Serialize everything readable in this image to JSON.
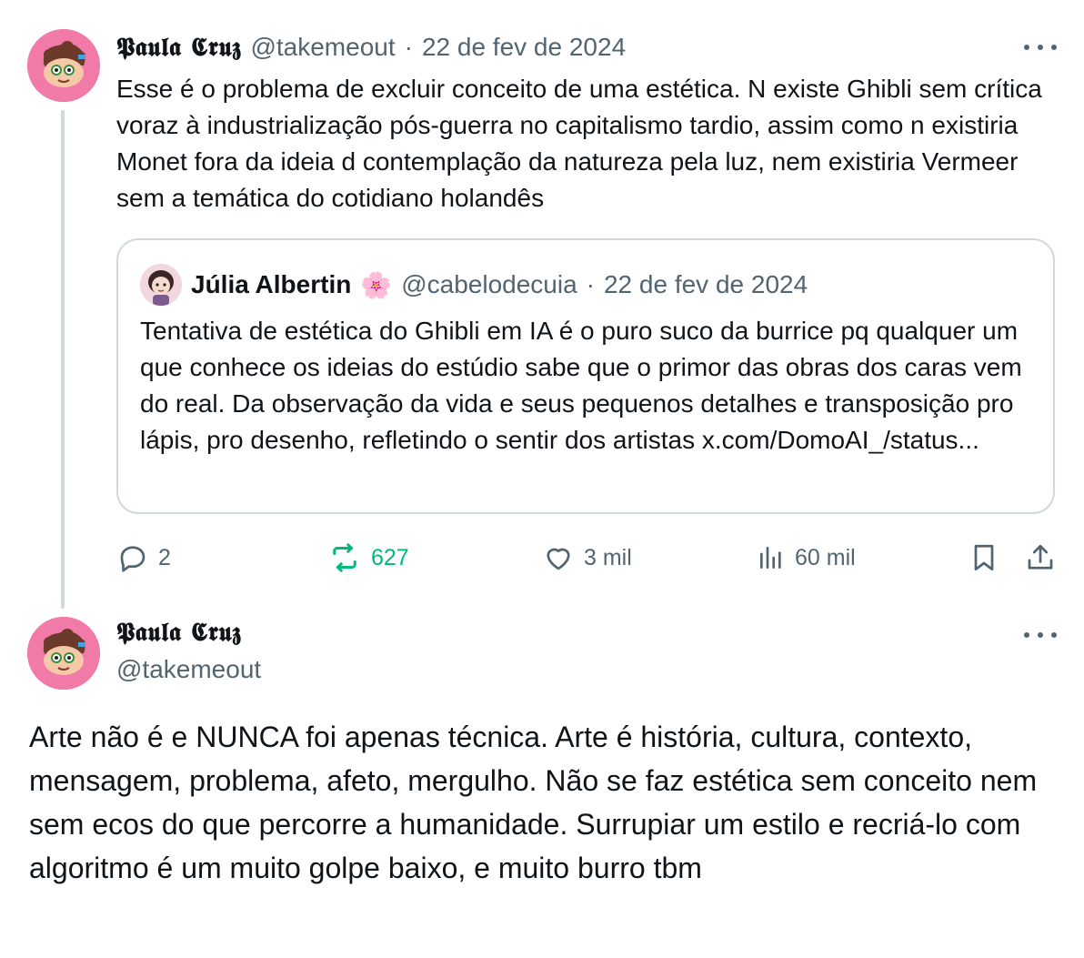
{
  "tweet1": {
    "author_name": "𝕻𝖆𝖚𝖑𝖆 𝕮𝖗𝖚𝖟",
    "handle": "@takemeout",
    "separator": "·",
    "date": "22 de fev de 2024",
    "text": "Esse é o problema de excluir conceito de uma estética. N existe Ghibli sem crítica voraz à industrialização pós-guerra no capitalismo tardio, assim como n existiria Monet fora da ideia d contemplação da natureza pela luz, nem existiria Vermeer sem a temática do cotidiano holandês",
    "quote": {
      "author_name": "Júlia Albertin",
      "emoji": "🌸",
      "handle": "@cabelodecuia",
      "separator": "·",
      "date": "22 de fev de 2024",
      "text": "Tentativa de estética do Ghibli em IA é o puro suco da burrice pq qualquer um que conhece os ideias do estúdio sabe que o primor das obras dos caras vem do real. Da observação da vida e seus pequenos detalhes e transposição pro lápis, pro desenho, refletindo o sentir dos artistas x.com/DomoAI_/status..."
    },
    "actions": {
      "replies": "2",
      "reposts": "627",
      "likes": "3 mil",
      "views": "60 mil"
    }
  },
  "tweet2": {
    "author_name": "𝕻𝖆𝖚𝖑𝖆 𝕮𝖗𝖚𝖟",
    "handle": "@takemeout",
    "text": "Arte não é e NUNCA foi apenas técnica. Arte é história, cultura, contexto, mensagem, problema, afeto, mergulho. Não se faz estética sem conceito nem sem ecos do que percorre a humanidade. Surrupiar um estilo e recriá-lo com algoritmo é um muito golpe baixo, e muito burro tbm"
  },
  "icons": {
    "more": "more-horizontal-icon",
    "reply": "reply-icon",
    "repost": "repost-icon",
    "like": "heart-icon",
    "views": "views-icon",
    "bookmark": "bookmark-icon",
    "share": "share-icon"
  },
  "colors": {
    "text": "#0f1419",
    "muted": "#536471",
    "repost_active": "#00ba7c",
    "border": "#cfd9de",
    "avatar_bg": "#f27aa8"
  }
}
